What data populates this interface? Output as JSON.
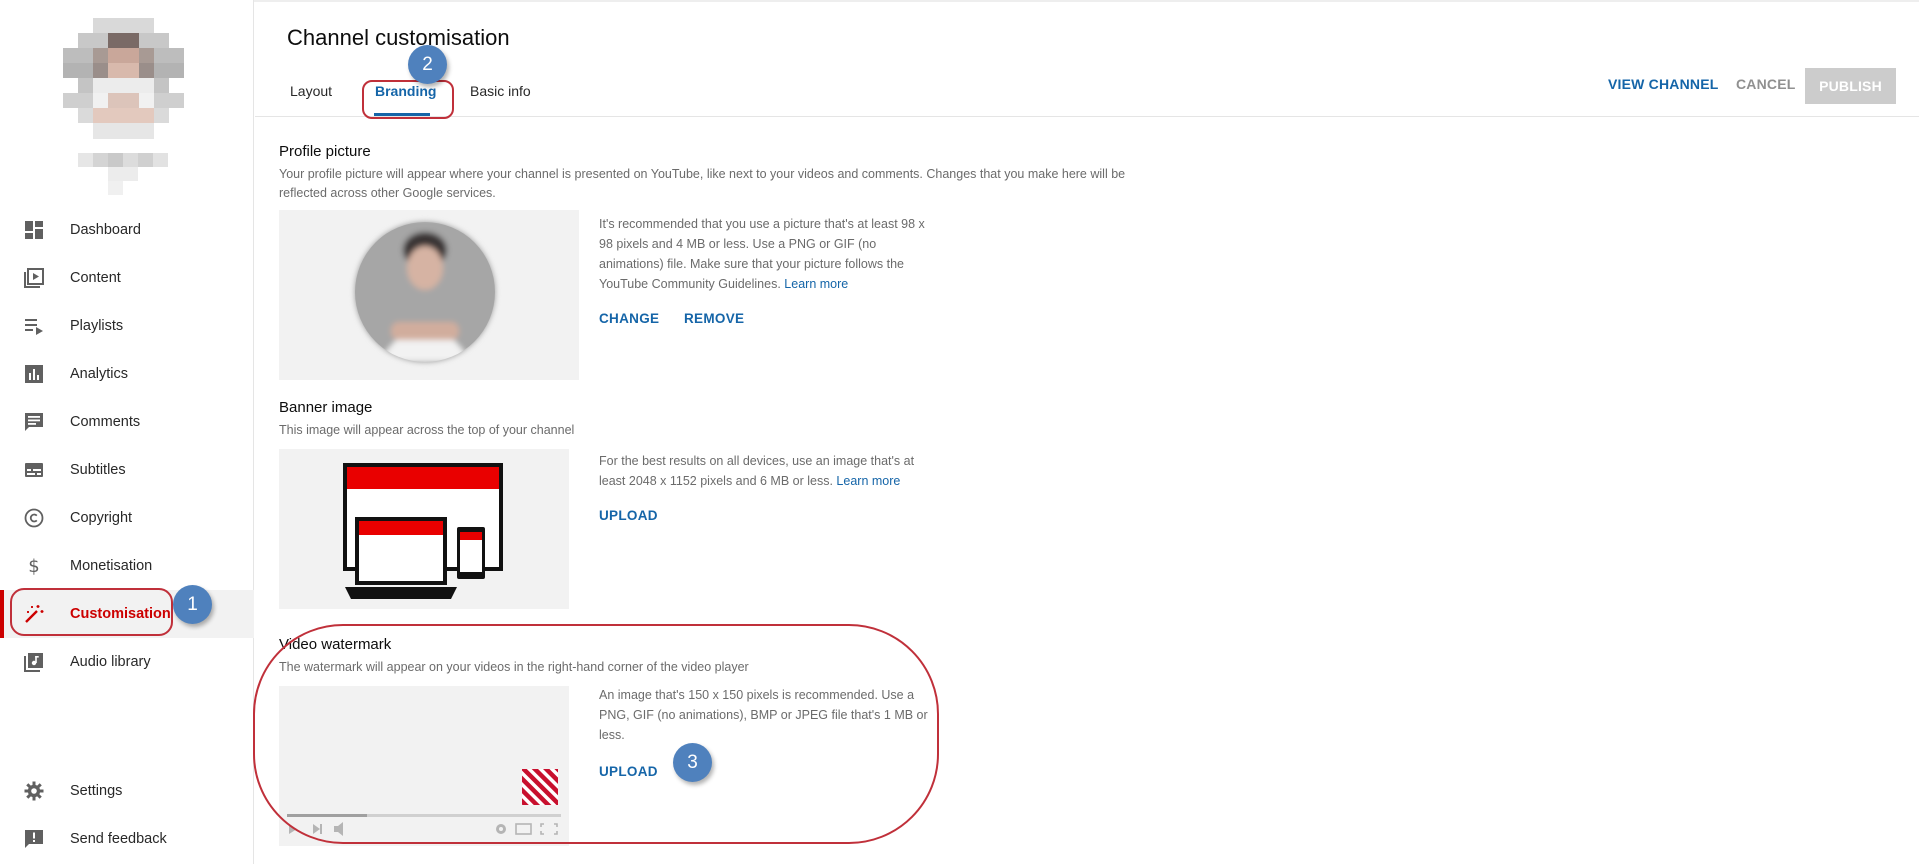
{
  "sidebar": {
    "nav_items": [
      {
        "label": "Dashboard",
        "icon": "dashboard-icon"
      },
      {
        "label": "Content",
        "icon": "content-icon"
      },
      {
        "label": "Playlists",
        "icon": "playlists-icon"
      },
      {
        "label": "Analytics",
        "icon": "analytics-icon"
      },
      {
        "label": "Comments",
        "icon": "comments-icon"
      },
      {
        "label": "Subtitles",
        "icon": "subtitles-icon"
      },
      {
        "label": "Copyright",
        "icon": "copyright-icon"
      },
      {
        "label": "Monetisation",
        "icon": "monetisation-icon"
      },
      {
        "label": "Customisation",
        "icon": "customisation-icon",
        "active": true
      },
      {
        "label": "Audio library",
        "icon": "audio-library-icon"
      }
    ],
    "bottom_items": [
      {
        "label": "Settings",
        "icon": "gear-icon"
      },
      {
        "label": "Send feedback",
        "icon": "feedback-icon"
      }
    ]
  },
  "header": {
    "title": "Channel customisation",
    "tabs": [
      {
        "label": "Layout"
      },
      {
        "label": "Branding",
        "active": true
      },
      {
        "label": "Basic info"
      }
    ],
    "view_channel": "VIEW CHANNEL",
    "cancel": "CANCEL",
    "publish": "PUBLISH"
  },
  "profile": {
    "title": "Profile picture",
    "desc_line1": "Your profile picture will appear where your channel is presented on YouTube, like next to your videos and comments. Changes that you make here will be",
    "desc_line2": "reflected across other Google services.",
    "info": "It's recommended that you use a picture that's at least 98 x 98 pixels and 4 MB or less. Use a PNG or GIF (no animations) file. Make sure that your picture follows the YouTube Community Guidelines.",
    "learn_more": "Learn more",
    "change": "CHANGE",
    "remove": "REMOVE"
  },
  "banner": {
    "title": "Banner image",
    "desc": "This image will appear across the top of your channel",
    "info": "For the best results on all devices, use an image that's at least 2048 x 1152 pixels and 6 MB or less.",
    "learn_more": "Learn more",
    "upload": "UPLOAD"
  },
  "watermark": {
    "title": "Video watermark",
    "desc": "The watermark will appear on your videos in the right-hand corner of the video player",
    "info": "An image that's 150 x 150 pixels is recommended. Use a PNG, GIF (no animations), BMP or JPEG file that's 1 MB or less.",
    "upload": "UPLOAD"
  },
  "annotations": {
    "badge1": "1",
    "badge2": "2",
    "badge3": "3",
    "outline_color": "#c0303a",
    "badge_color": "#4f81bd"
  },
  "colors": {
    "accent_blue": "#1565a8",
    "active_red": "#cc0000",
    "muted_text": "#6b6b6b"
  }
}
